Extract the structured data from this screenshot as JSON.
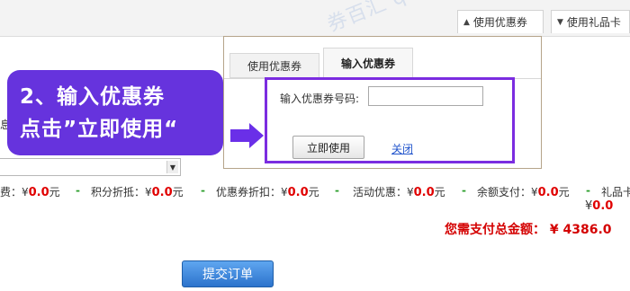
{
  "top_tabs": {
    "use_coupon": "使用优惠券",
    "use_gift_card": "使用礼品卡"
  },
  "watermark": "券百汇 quanbaihui",
  "popup": {
    "tab_use": "使用优惠券",
    "tab_input": "输入优惠券",
    "code_label": "输入优惠券号码:",
    "code_value": "",
    "apply_button": "立即使用",
    "close_link": "关闭"
  },
  "callout": {
    "line1": "2、输入优惠券",
    "line2": "点击”立即使用“"
  },
  "left_fragment": "息",
  "summary": {
    "items": [
      {
        "label": "费：¥",
        "amount": "0.0",
        "unit": "元"
      },
      {
        "label": "积分折抵：¥",
        "amount": "0.0",
        "unit": "元"
      },
      {
        "label": "优惠券折扣：¥",
        "amount": "0.0",
        "unit": "元"
      },
      {
        "label": "活动优惠：¥",
        "amount": "0.0",
        "unit": "元"
      },
      {
        "label": "余额支付：¥",
        "amount": "0.0",
        "unit": "元"
      },
      {
        "label": "礼品卡",
        "amount": "",
        "unit": ""
      }
    ],
    "separator": "-",
    "gift_currency": "¥",
    "gift_amount": "0.0"
  },
  "total": {
    "label": "您需支付总金额：",
    "currency": "¥",
    "amount": "4386.0"
  },
  "submit_button": "提交订单",
  "colors": {
    "accent_purple": "#6633dd",
    "amount_red": "#e00000",
    "separator_green": "#2a9d2a",
    "submit_blue": "#2c73cc"
  }
}
